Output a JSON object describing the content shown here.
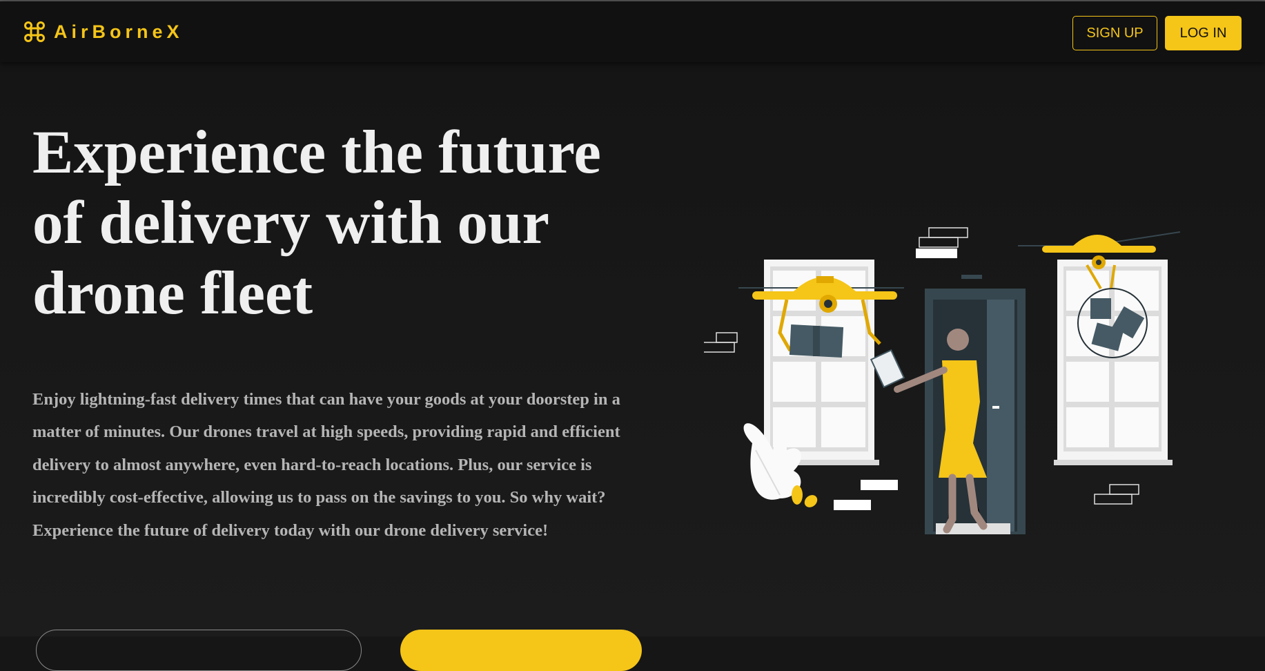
{
  "brand": {
    "name": "AirBorneX",
    "icon": "drone-icon",
    "accent_color": "#f5c518"
  },
  "nav": {
    "signup_label": "SIGN UP",
    "login_label": "LOG IN"
  },
  "hero": {
    "headline": "Experience the future of delivery with our drone fleet",
    "body": "Enjoy lightning-fast delivery times that can have your goods at your doorstep in a matter of minutes. Our drones travel at high speeds, providing rapid and efficient delivery to almost anywhere, even hard-to-reach locations. Plus, our service is incredibly cost-effective, allowing us to pass on the savings to you. So why wait? Experience the future of delivery today with our drone delivery service!"
  },
  "illustration": {
    "name": "drone-delivery-illustration"
  },
  "colors": {
    "background": "#161616",
    "navbar": "#111111",
    "headline": "#efefef",
    "body_text": "#b5b5b5"
  }
}
